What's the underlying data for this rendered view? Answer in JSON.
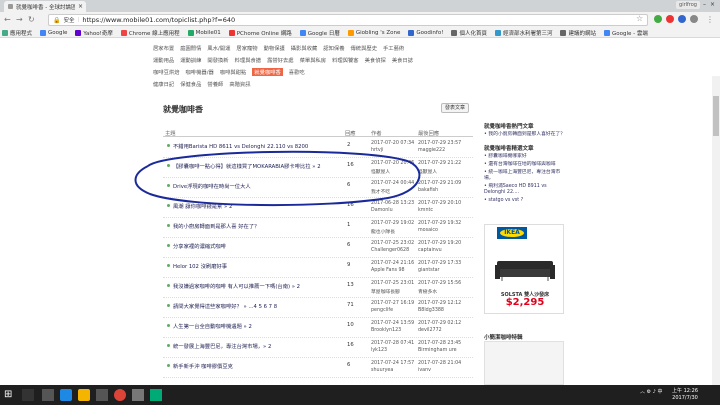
{
  "browser": {
    "tab_title": "就覺咖啡香 - 全球討論區",
    "profile": "girlfrog",
    "security_label": "安全",
    "url": "https://www.mobile01.com/topiclist.php?f=640"
  },
  "bookmarks": [
    {
      "label": "應用程式",
      "color": "#4a8"
    },
    {
      "label": "Google",
      "color": "#4285f4"
    },
    {
      "label": "Yahoo!奇摩",
      "color": "#6001d2"
    },
    {
      "label": "Chrome 線上應用程",
      "color": "#e44"
    },
    {
      "label": "Mobile01",
      "color": "#2a6"
    },
    {
      "label": "PChome Online 網路",
      "color": "#e33"
    },
    {
      "label": "Google 日曆",
      "color": "#4285f4"
    },
    {
      "label": "Giobling 's Zone",
      "color": "#f90"
    },
    {
      "label": "Goodinfo!",
      "color": "#36c"
    },
    {
      "label": "個人化首頁",
      "color": "#666"
    },
    {
      "label": "經濟部水利署第三河",
      "color": "#39c"
    },
    {
      "label": "建議的網站",
      "color": "#666"
    },
    {
      "label": "Google - 雲端",
      "color": "#4285f4"
    }
  ],
  "subnav": {
    "row1": [
      "居家布置",
      "庭園閒情",
      "風水/開運",
      "居家寵物",
      "動物保護",
      "攝影與收藏",
      "認知保養",
      "傳統與歷史",
      "手工藝術"
    ],
    "row2": [
      "運動用品",
      "運動訓練",
      "開發換新",
      "料理與食譜",
      "露營好去處",
      "菜單與私房",
      "料理與饕客",
      "美食偵探",
      "美食日誌"
    ],
    "row3": [
      "咖啡豆烘焙",
      "咖啡機器/器",
      "咖啡與甜點",
      "就覺咖啡香",
      "喜歡吃"
    ],
    "row4": [
      "健康日記",
      "保健食品",
      "營養師",
      "高階資訊"
    ],
    "active": "就覺咖啡香"
  },
  "forum": {
    "title": "就覺咖啡香",
    "post_button": "發表文章",
    "col_topic": "主題",
    "col_replies": "回應",
    "col_author": "作者",
    "col_last": "最後回應"
  },
  "topics": [
    {
      "title": "不錯用Barista HD 8611 vs Delonghi 22.110 vs 8200",
      "replies": "2",
      "author_date": "2017-07-20 07:34",
      "author": "hrtvji",
      "last_date": "2017-07-29 23:57",
      "last_user": "maggie222"
    },
    {
      "title": "【膠囊咖啡一點心得】就這樣買了MOKARABIA膠卡啡比拉 » 2",
      "replies": "16",
      "author_date": "2017-07-20 20:46",
      "author": "怪獸屋人",
      "last_date": "2017-07-29 21:22",
      "last_user": "怪獸屋人"
    },
    {
      "title": "Drive浮現的咖啡在時尚一位大人",
      "replies": "6",
      "author_date": "2017-07-24 00:44",
      "author": "我才不吃",
      "last_date": "2017-07-29 21:09",
      "last_user": "bakafish"
    },
    {
      "title": "風潮 讓你咖啡錢是累 » 2",
      "replies": "16",
      "author_date": "2017-06-28 13:23",
      "author": "Damonlu",
      "last_date": "2017-07-29 20:10",
      "last_user": "kmntc"
    },
    {
      "title": "我的小廚房轉面到是那人喜 好在了？",
      "replies": "1",
      "author_date": "2017-07-29 19:02",
      "author": "龍也小隊長",
      "last_date": "2017-07-29 19:32",
      "last_user": "mosaico"
    },
    {
      "title": "分享家裡的濃縮式咖啡",
      "replies": "6",
      "author_date": "2017-07-25 23:02",
      "author": "Challenger0628",
      "last_date": "2017-07-29 19:20",
      "last_user": "captainvu"
    },
    {
      "title": "Helor 102 沒刷磨好事",
      "replies": "9",
      "author_date": "2017-07-24 21:16",
      "author": "Apple Fans 98",
      "last_date": "2017-07-29 17:33",
      "last_user": "giantstar"
    },
    {
      "title": "我沒嫌過家咖啡的咖啡 有人可以推薦一下嗎(台南) » 2",
      "replies": "13",
      "author_date": "2017-07-25 23:01",
      "author": "草屋咖啡長腳",
      "last_date": "2017-07-29 15:56",
      "last_user": "青樹多水"
    },
    {
      "title": "請問大家覺得這些家咖啡好？ » ...4 5 6 7 8",
      "replies": "71",
      "author_date": "2017-07-27 16:19",
      "author": "pengclife",
      "last_date": "2017-07-29 12:12",
      "last_user": "B8ldg3388"
    },
    {
      "title": "人生第一台全自動咖啡機遇題 » 2",
      "replies": "10",
      "author_date": "2017-07-24 13:59",
      "author": "Brooklyn123",
      "last_date": "2017-07-29 02:12",
      "last_user": "devil2772"
    },
    {
      "title": "統一發展上海豐巴尼，專注台灣市場，» 2",
      "replies": "16",
      "author_date": "2017-07-28 07:41",
      "author": "lyk123",
      "last_date": "2017-07-28 23:45",
      "last_user": "Birmingham ure"
    },
    {
      "title": "新手新手沖 咖啡膠價豆克",
      "replies": "6",
      "author_date": "2017-07-24 17:57",
      "author": "shuuryea",
      "last_date": "2017-07-28 21:04",
      "last_user": "ivanv"
    }
  ],
  "sidebar": {
    "popular_title": "就覺咖啡香熱門文章",
    "popular": [
      "我的小廚房轉面到是那人喜好在了？"
    ],
    "hot_title": "就覺咖啡香精選文章",
    "hot": [
      "膠囊咖啡機哪家好",
      "還有台灣咖啡在地的咖啡與咖啡",
      "統一咖啡上海豐巴尼，專注台灣市場，",
      "飛利浦Saeco HD 8911 vs Delonghi 22....",
      "statgo vs vst ?"
    ],
    "ad_brand": "IKEA",
    "ad_product": "SOLSTA 雙人沙發床",
    "ad_price": "$2,295",
    "promo_title": "小簡潔咖啡特輯"
  },
  "taskbar": {
    "time": "上午 12:26",
    "date": "2017/7/30"
  }
}
